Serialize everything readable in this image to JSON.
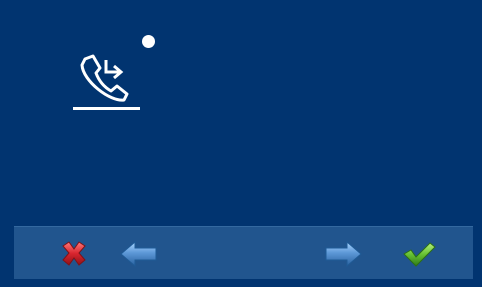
{
  "screen": {
    "background_color": "#013470",
    "status_indicator": {
      "color": "#ffffff"
    },
    "main_icon": {
      "name": "call-forward-icon",
      "color": "#ffffff",
      "selected": true
    }
  },
  "toolbar": {
    "background_color": "#21558e",
    "buttons": [
      {
        "id": "cancel",
        "icon": "red-x-icon",
        "color": "#d8252e"
      },
      {
        "id": "back",
        "icon": "left-arrow-icon",
        "color": "#5d98d7"
      },
      {
        "id": "next",
        "icon": "right-arrow-icon",
        "color": "#5d98d7"
      },
      {
        "id": "confirm",
        "icon": "green-check-icon",
        "color": "#66c132"
      }
    ]
  }
}
